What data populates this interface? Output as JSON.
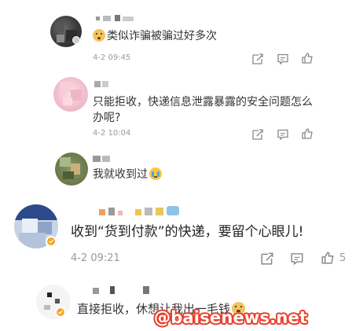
{
  "comments": [
    {
      "text": "类似诈骗被骗过好多次",
      "time": "4-2 09:45",
      "emoji": "doge-emoji"
    },
    {
      "text_line1": "只能拒收，快递信息泄露暴露的安全问题怎么",
      "text_line2": "办呢?",
      "time": "4-2 10:04"
    },
    {
      "text": "我就收到过",
      "emoji": "crying-emoji"
    },
    {
      "text": "收到“货到付款”的快递，要留个心眼儿!",
      "time": "4-2 09:21",
      "likes": "5"
    },
    {
      "text": "直接拒收，休想让我出一毛钱",
      "emoji": "doge-emoji"
    }
  ],
  "watermark": "@baisenews.net",
  "colors": {
    "text": "#333333",
    "meta": "#9a9a9a",
    "watermark_outline": "#e8402b",
    "verified_badge": "#f5a623"
  }
}
